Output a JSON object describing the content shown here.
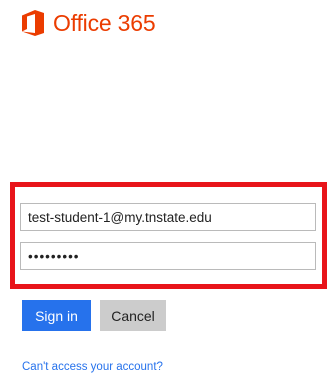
{
  "brand": {
    "name": "Office 365",
    "logo_icon": "office-logo-icon",
    "color": "#eb3c00"
  },
  "login_form": {
    "username_value": "test-student-1@my.tnstate.edu",
    "password_mask": "•••••••••",
    "highlight_color": "#e8141a"
  },
  "actions": {
    "signin_label": "Sign in",
    "cancel_label": "Cancel",
    "signin_color": "#2672ec",
    "cancel_color": "#cccccc"
  },
  "help": {
    "cant_access_label": "Can't access your account?"
  }
}
